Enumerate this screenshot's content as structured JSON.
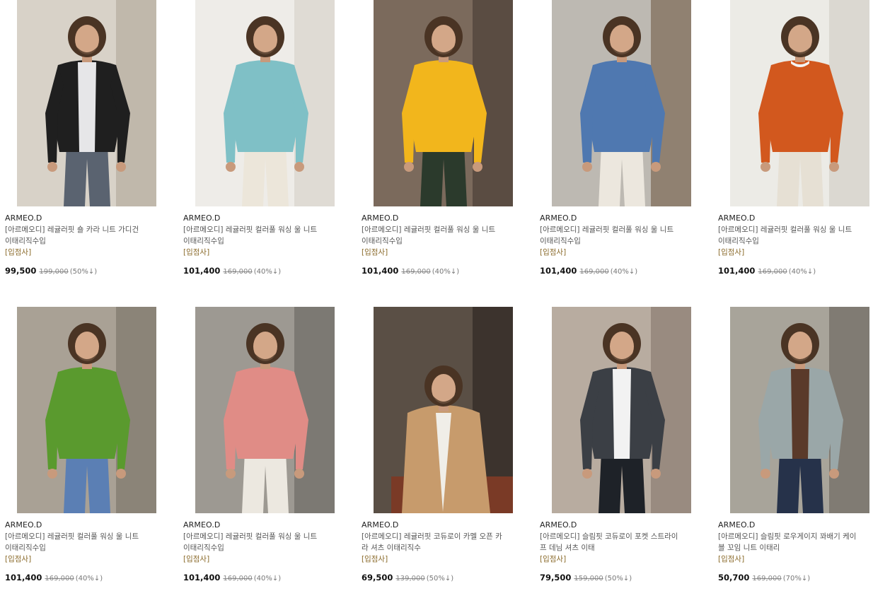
{
  "products": [
    {
      "brand": "ARMEO.D",
      "name": "[아르메오디] 레귤러핏 숄 카라 니트 가디건 이태리직수입",
      "tag": "[입점사]",
      "sale_price": "99,500",
      "original_price": "199,000",
      "discount": "(50%↓)",
      "sweater_color": "#1f1f1f",
      "inner_color": "#e6e6e8",
      "pants_color": "#5a6370",
      "bg_color": "#d8d2c8",
      "bg2_color": "#b7ad9e",
      "garment": "cardigan"
    },
    {
      "brand": "ARMEO.D",
      "name": "[아르메오디] 레귤러핏 컬러풀 워싱 울 니트 이태리직수입",
      "tag": "[입점사]",
      "sale_price": "101,400",
      "original_price": "169,000",
      "discount": "(40%↓)",
      "sweater_color": "#7fc0c6",
      "inner_color": "#7fc0c6",
      "pants_color": "#ece6da",
      "bg_color": "#eeece8",
      "bg2_color": "#d9d4cc",
      "garment": "sweater"
    },
    {
      "brand": "ARMEO.D",
      "name": "[아르메오디] 레귤러핏 컬러풀 워싱 울 니트 이태리직수입",
      "tag": "[입점사]",
      "sale_price": "101,400",
      "original_price": "169,000",
      "discount": "(40%↓)",
      "sweater_color": "#f2b61c",
      "inner_color": "#f2b61c",
      "pants_color": "#2b3a2c",
      "bg_color": "#7b6a5c",
      "bg2_color": "#4d4038",
      "garment": "sweater"
    },
    {
      "brand": "ARMEO.D",
      "name": "[아르메오디] 레귤러핏 컬러풀 워싱 울 니트 이태리직수입",
      "tag": "[입점사]",
      "sale_price": "101,400",
      "original_price": "169,000",
      "discount": "(40%↓)",
      "sweater_color": "#4f78b0",
      "inner_color": "#4f78b0",
      "pants_color": "#ece7de",
      "bg_color": "#bdb9b2",
      "bg2_color": "#7d6a55",
      "garment": "sweater"
    },
    {
      "brand": "ARMEO.D",
      "name": "[아르메오디] 레귤러핏 컬러풀 워싱 울 니트 이태리직수입",
      "tag": "[입점사]",
      "sale_price": "101,400",
      "original_price": "169,000",
      "discount": "(40%↓)",
      "sweater_color": "#d2581e",
      "inner_color": "#f4f4f4",
      "pants_color": "#e6e0d4",
      "bg_color": "#ecebe6",
      "bg2_color": "#d4d0c8",
      "garment": "sweater"
    },
    {
      "brand": "ARMEO.D",
      "name": "[아르메오디] 레귤러핏 컬러풀 워싱 울 니트 이태리직수입",
      "tag": "[입점사]",
      "sale_price": "101,400",
      "original_price": "169,000",
      "discount": "(40%↓)",
      "sweater_color": "#5a9a2e",
      "inner_color": "#5a9a2e",
      "pants_color": "#5b7fb4",
      "bg_color": "#a9a195",
      "bg2_color": "#7f776c",
      "garment": "sweater"
    },
    {
      "brand": "ARMEO.D",
      "name": "[아르메오디] 레귤러핏 컬러풀 워싱 울 니트 이태리직수입",
      "tag": "[입점사]",
      "sale_price": "101,400",
      "original_price": "169,000",
      "discount": "(40%↓)",
      "sweater_color": "#e08c86",
      "inner_color": "#e08c86",
      "pants_color": "#ece8e0",
      "bg_color": "#9d9992",
      "bg2_color": "#6e6b66",
      "garment": "sweater"
    },
    {
      "brand": "ARMEO.D",
      "name": "[아르메오디] 레귤러핏 코듀로이 카멜 오픈 카라 셔츠 이태리직수",
      "tag": "[입점사]",
      "sale_price": "69,500",
      "original_price": "139,000",
      "discount": "(50%↓)",
      "sweater_color": "#c79b6c",
      "inner_color": "#f0eee8",
      "pants_color": "#7a3a26",
      "bg_color": "#5a4f45",
      "bg2_color": "#2f2823",
      "garment": "seated"
    },
    {
      "brand": "ARMEO.D",
      "name": "[아르메오디] 슬림핏 코듀로이 포켓 스트라이프 데님 셔츠 이태",
      "tag": "[입점사]",
      "sale_price": "79,500",
      "original_price": "159,000",
      "discount": "(50%↓)",
      "sweater_color": "#3b3f45",
      "inner_color": "#f2f2f2",
      "pants_color": "#1e2228",
      "bg_color": "#b8aca0",
      "bg2_color": "#8b7e72",
      "garment": "shirt"
    },
    {
      "brand": "ARMEO.D",
      "name": "[아르메오디] 슬림핏 로우게이지 꽈배기 케이블 꼬임 니트 이태리",
      "tag": "[입점사]",
      "sale_price": "50,700",
      "original_price": "169,000",
      "discount": "(70%↓)",
      "sweater_color": "#9aa7a8",
      "inner_color": "#5a3a2a",
      "pants_color": "#26324a",
      "bg_color": "#a8a49a",
      "bg2_color": "#6f6a62",
      "garment": "jacket"
    }
  ]
}
